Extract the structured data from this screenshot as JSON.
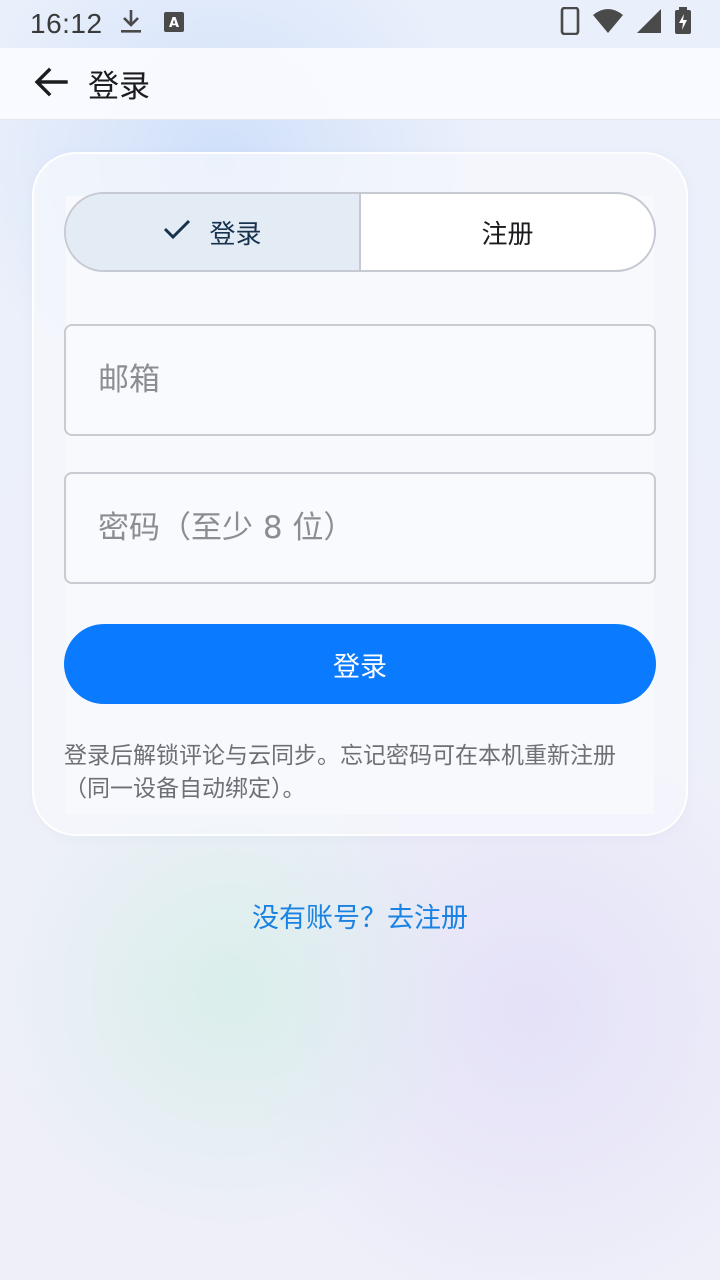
{
  "status_bar": {
    "time": "16:12",
    "icons": [
      "download-icon",
      "keyboard-a-icon",
      "phone-icon",
      "wifi-icon",
      "signal-icon",
      "battery-charging-icon"
    ]
  },
  "app_bar": {
    "title": "登录",
    "back_icon": "arrow-left-icon"
  },
  "tabs": [
    {
      "label": "登录",
      "selected": true,
      "icon": "check-icon"
    },
    {
      "label": "注册",
      "selected": false
    }
  ],
  "form": {
    "email_placeholder": "邮箱",
    "email_value": "",
    "password_placeholder": "密码（至少 8 位）",
    "password_value": "",
    "submit_label": "登录"
  },
  "hint": "登录后解锁评论与云同步。忘记密码可在本机重新注册（同一设备自动绑定）。",
  "signup_link": "没有账号？去注册",
  "colors": {
    "primary": "#0a7aff",
    "link": "#1a82e2",
    "tab_selected_bg": "#e3ebf5"
  }
}
